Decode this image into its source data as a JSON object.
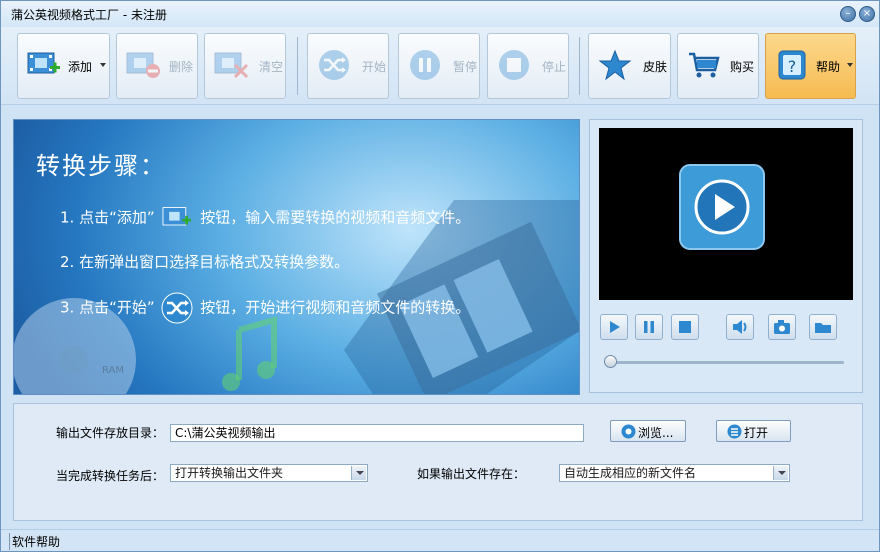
{
  "window": {
    "title": "蒲公英视频格式工厂 - 未注册",
    "minimize_glyph": "–",
    "close_glyph": "×"
  },
  "toolbar": {
    "add": "添加",
    "delete": "删除",
    "clear": "清空",
    "start": "开始",
    "pause": "暂停",
    "stop": "停止",
    "skin": "皮肤",
    "buy": "购买",
    "help": "帮助"
  },
  "banner": {
    "title": "转换步骤：",
    "step1_a": "1. 点击“添加”",
    "step1_b": "按钮，输入需要转换的视频和音频文件。",
    "step2": "2. 在新弹出窗口选择目标格式及转换参数。",
    "step3_a": "3. 点击“开始”",
    "step3_b": "按钮，开始进行视频和音频文件的转换。",
    "disc_label": "RAM"
  },
  "player": {
    "progress": 0
  },
  "settings": {
    "output_dir_label": "输出文件存放目录：",
    "output_dir_value": "C:\\蒲公英视频输出",
    "browse": "浏览...",
    "open": "打开",
    "after_label": "当完成转换任务后：",
    "after_value": "打开转换输出文件夹",
    "exists_label": "如果输出文件存在：",
    "exists_value": "自动生成相应的新文件名"
  },
  "statusbar": {
    "text": "软件帮助"
  },
  "colors": {
    "accent": "#2577c0",
    "help_button": "#f6bb52",
    "play": "#2e88cf"
  }
}
